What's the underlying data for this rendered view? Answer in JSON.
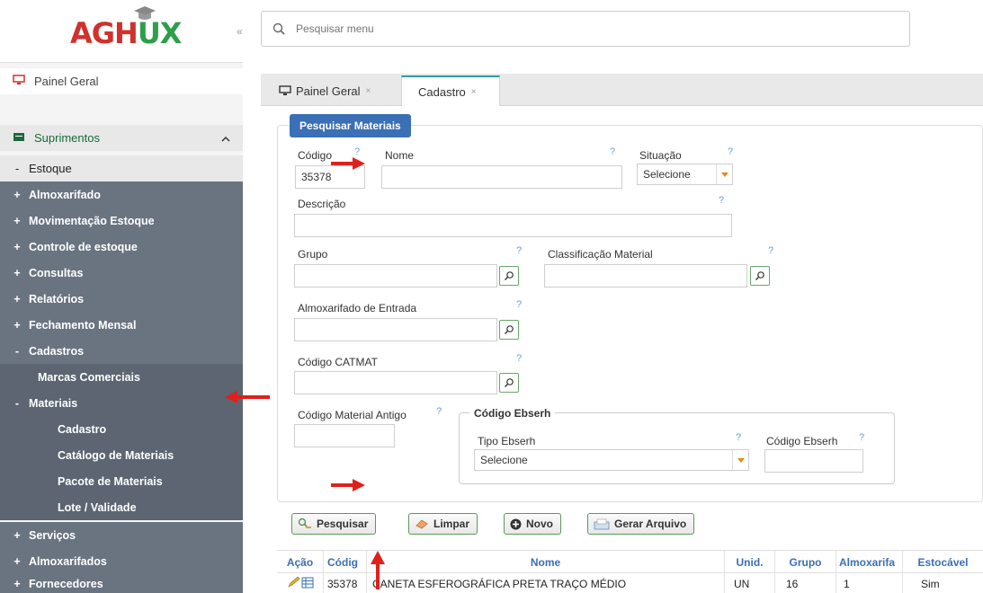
{
  "app": {
    "logo_text_red": "AGH",
    "logo_text_green": "UX"
  },
  "search": {
    "placeholder": "Pesquisar menu"
  },
  "sidebar": {
    "painel_geral": "Painel Geral",
    "suprimentos": "Suprimentos",
    "estoque": "Estoque",
    "items": [
      {
        "prefix": "+",
        "label": "Almoxarifado"
      },
      {
        "prefix": "+",
        "label": "Movimentação Estoque"
      },
      {
        "prefix": "+",
        "label": "Controle de estoque"
      },
      {
        "prefix": "+",
        "label": "Consultas"
      },
      {
        "prefix": "+",
        "label": "Relatórios"
      },
      {
        "prefix": "+",
        "label": "Fechamento Mensal"
      },
      {
        "prefix": "-",
        "label": "Cadastros"
      }
    ],
    "marcas": "Marcas Comerciais",
    "materiais": {
      "prefix": "-",
      "label": "Materiais"
    },
    "sub": [
      "Cadastro",
      "Catálogo de Materiais",
      "Pacote de Materiais",
      "Lote / Validade"
    ],
    "bottom": [
      {
        "prefix": "+",
        "label": "Serviços"
      },
      {
        "prefix": "+",
        "label": "Almoxarifados"
      },
      {
        "prefix": "+",
        "label": "Fornecedores"
      }
    ]
  },
  "tabs": [
    {
      "label": "Painel Geral",
      "close": "×"
    },
    {
      "label": "Cadastro",
      "close": "×"
    }
  ],
  "form": {
    "title": "Pesquisar Materiais",
    "help": "?",
    "codigo": {
      "label": "Código",
      "value": "35378"
    },
    "nome": {
      "label": "Nome",
      "value": ""
    },
    "situacao": {
      "label": "Situação",
      "value": "Selecione"
    },
    "descricao": {
      "label": "Descrição",
      "value": ""
    },
    "grupo": {
      "label": "Grupo",
      "value": ""
    },
    "classificacao": {
      "label": "Classificação Material",
      "value": ""
    },
    "almox_entrada": {
      "label": "Almoxarifado de Entrada",
      "value": ""
    },
    "catmat": {
      "label": "Código CATMAT",
      "value": ""
    },
    "cod_antigo": {
      "label": "Código Material Antigo",
      "value": ""
    },
    "ebserh": {
      "legend": "Código Ebserh",
      "tipo": {
        "label": "Tipo Ebserh",
        "value": "Selecione"
      },
      "codigo": {
        "label": "Código Ebserh",
        "value": ""
      }
    }
  },
  "buttons": {
    "pesquisar": "Pesquisar",
    "limpar": "Limpar",
    "novo": "Novo",
    "gerar": "Gerar Arquivo"
  },
  "table": {
    "headers": [
      "Ação",
      "Códig",
      "Nome",
      "Unid.",
      "Grupo",
      "Almoxarifa",
      "Estocável"
    ],
    "rows": [
      [
        "",
        "35378",
        "CANETA ESFEROGRÁFICA PRETA TRAÇO MÉDIO",
        "UN",
        "16",
        "1",
        "Sim"
      ]
    ]
  },
  "colors": {
    "accent_blue": "#3b6fb6",
    "sidebar_dark": "#6a7481",
    "button_border": "#5a9a5a",
    "annotation_arrow": "#e0201b"
  }
}
